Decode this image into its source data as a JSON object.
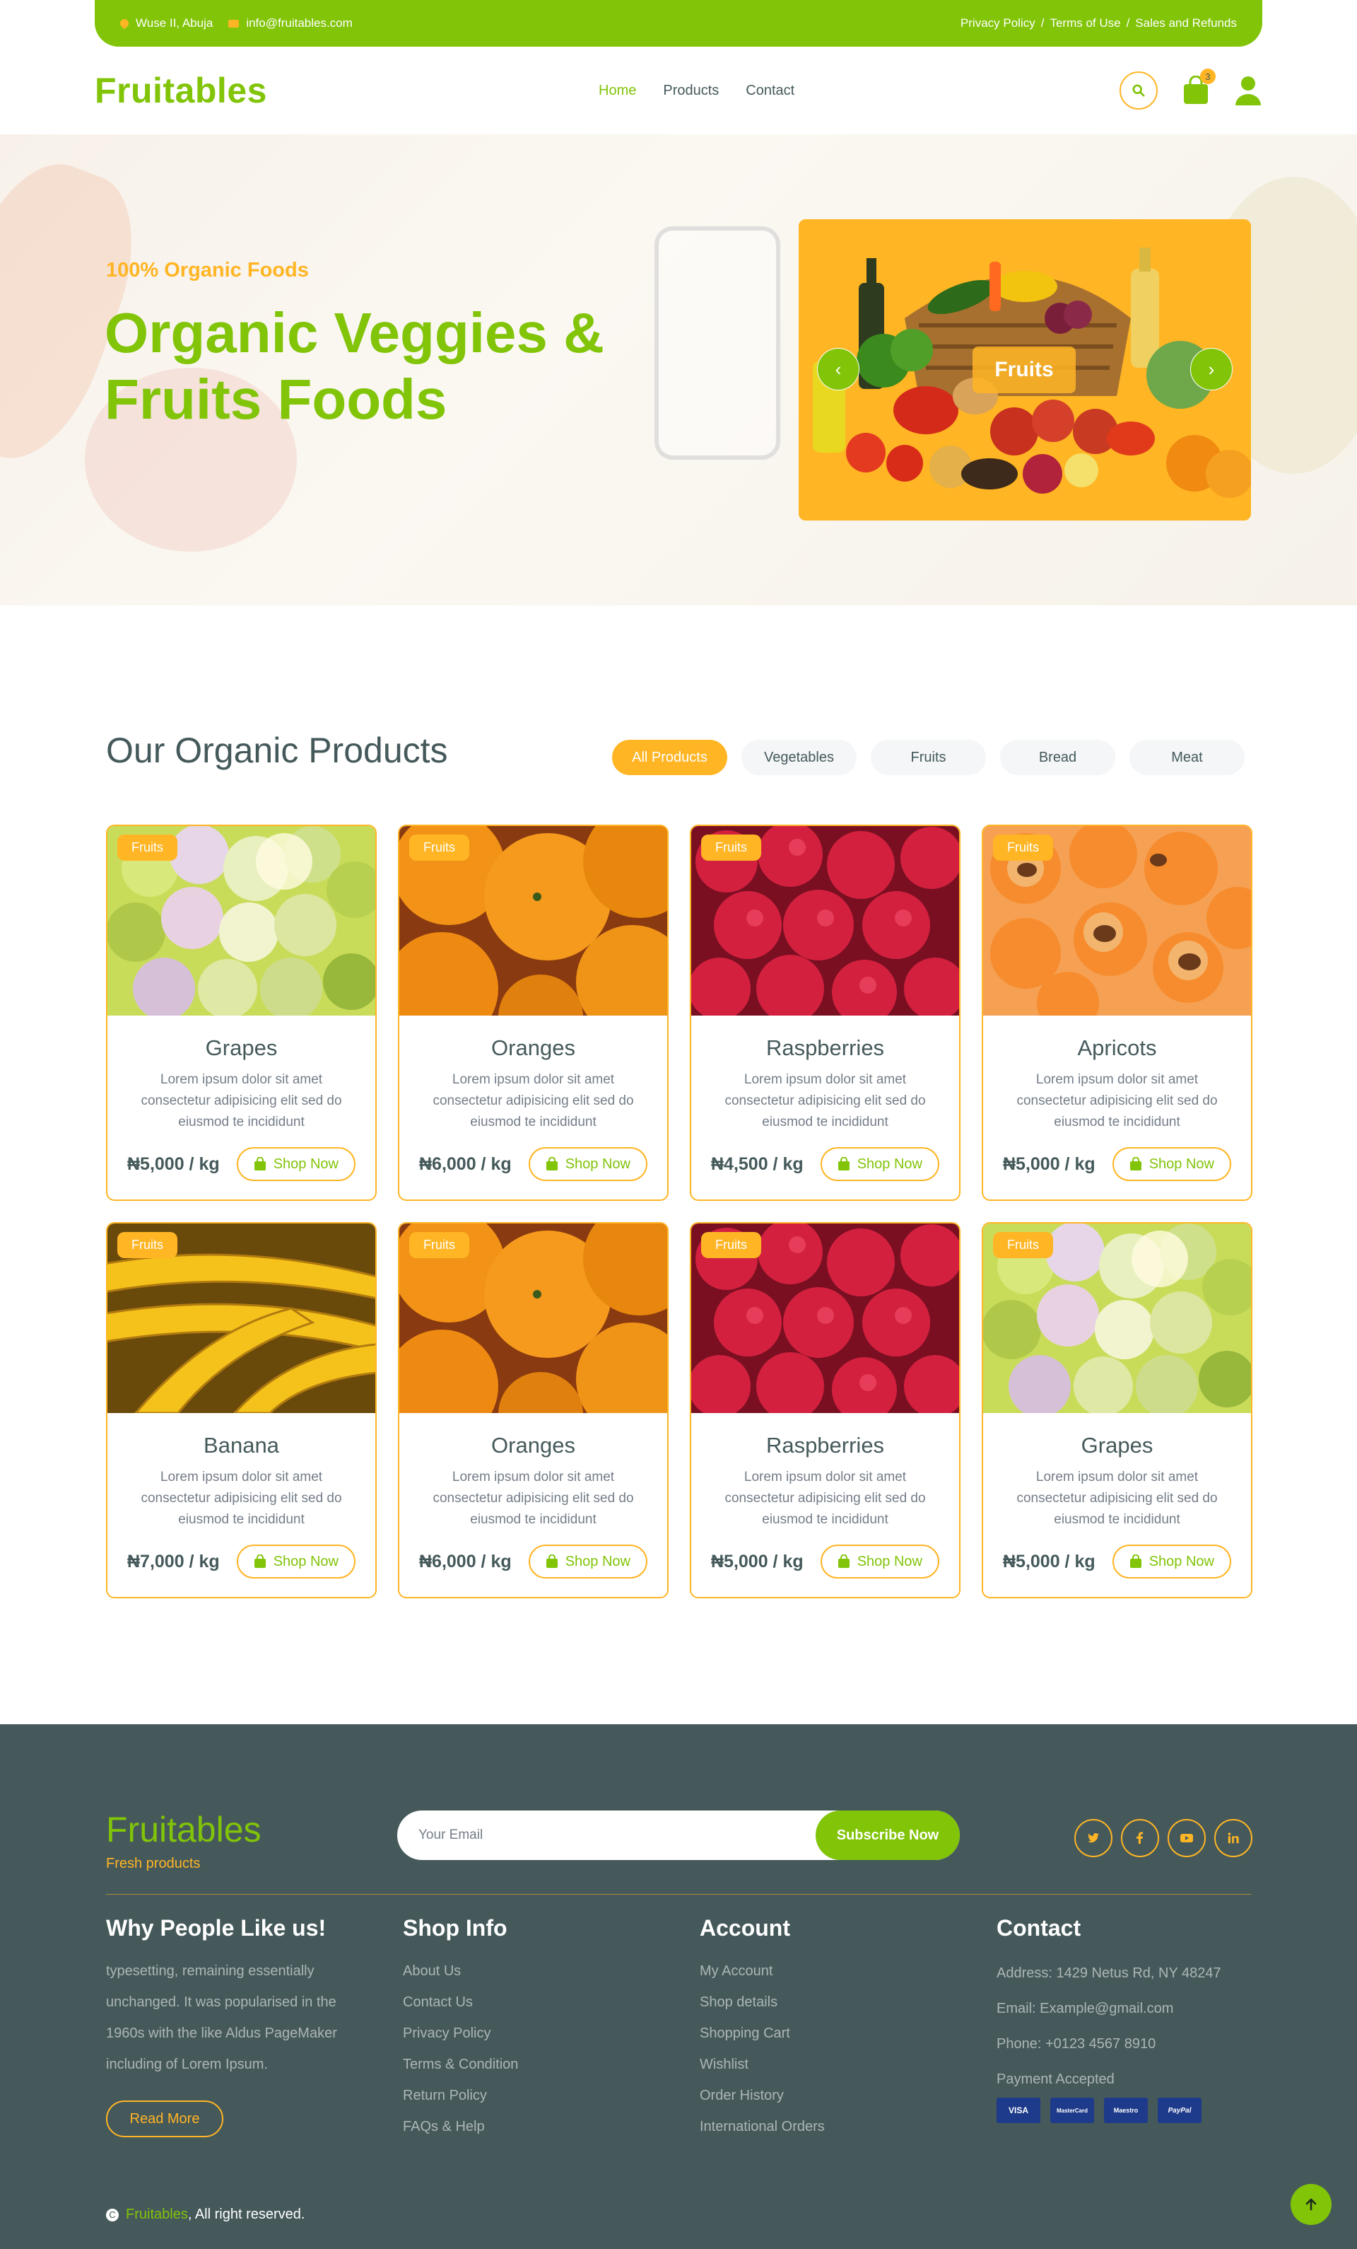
{
  "topbar": {
    "address": "Wuse II, Abuja",
    "email": "info@fruitables.com",
    "links": [
      "Privacy Policy",
      "Terms of Use",
      "Sales and Refunds"
    ],
    "separator": "/"
  },
  "nav": {
    "brand": "Fruitables",
    "menu": [
      "Home",
      "Products",
      "Contact"
    ],
    "active": "Home",
    "cart_count": "3",
    "icons": [
      "search-icon",
      "shopping-bag-icon",
      "user-icon"
    ]
  },
  "hero": {
    "subtitle": "100% Organic Foods",
    "title": "Organic Veggies & Fruits Foods",
    "carousel_label": "Fruits",
    "prev": "‹",
    "next": "›"
  },
  "products": {
    "title": "Our Organic Products",
    "filters": [
      "All Products",
      "Vegetables",
      "Fruits",
      "Bread",
      "Meat"
    ],
    "active_filter": "All Products",
    "items": [
      {
        "tag": "Fruits",
        "name": "Grapes",
        "desc": "Lorem ipsum dolor sit amet consectetur adipisicing elit sed do eiusmod te incididunt",
        "price": "₦5,000 / kg",
        "cta": "Shop Now"
      },
      {
        "tag": "Fruits",
        "name": "Oranges",
        "desc": "Lorem ipsum dolor sit amet consectetur adipisicing elit sed do eiusmod te incididunt",
        "price": "₦6,000 / kg",
        "cta": "Shop Now"
      },
      {
        "tag": "Fruits",
        "name": "Raspberries",
        "desc": "Lorem ipsum dolor sit amet consectetur adipisicing elit sed do eiusmod te incididunt",
        "price": "₦4,500 / kg",
        "cta": "Shop Now"
      },
      {
        "tag": "Fruits",
        "name": "Apricots",
        "desc": "Lorem ipsum dolor sit amet consectetur adipisicing elit sed do eiusmod te incididunt",
        "price": "₦5,000 / kg",
        "cta": "Shop Now"
      },
      {
        "tag": "Fruits",
        "name": "Banana",
        "desc": "Lorem ipsum dolor sit amet consectetur adipisicing elit sed do eiusmod te incididunt",
        "price": "₦7,000 / kg",
        "cta": "Shop Now"
      },
      {
        "tag": "Fruits",
        "name": "Oranges",
        "desc": "Lorem ipsum dolor sit amet consectetur adipisicing elit sed do eiusmod te incididunt",
        "price": "₦6,000 / kg",
        "cta": "Shop Now"
      },
      {
        "tag": "Fruits",
        "name": "Raspberries",
        "desc": "Lorem ipsum dolor sit amet consectetur adipisicing elit sed do eiusmod te incididunt",
        "price": "₦5,000 / kg",
        "cta": "Shop Now"
      },
      {
        "tag": "Fruits",
        "name": "Grapes",
        "desc": "Lorem ipsum dolor sit amet consectetur adipisicing elit sed do eiusmod te incididunt",
        "price": "₦5,000 / kg",
        "cta": "Shop Now"
      }
    ]
  },
  "footer": {
    "brand": "Fruitables",
    "tagline": "Fresh products",
    "subscribe_placeholder": "Your Email",
    "subscribe_button": "Subscribe Now",
    "socials": [
      "twitter-icon",
      "facebook-icon",
      "youtube-icon",
      "linkedin-icon"
    ],
    "about_title": "Why People Like us!",
    "about_text": "typesetting, remaining essentially unchanged. It was popularised in the 1960s with the like Aldus PageMaker including of Lorem Ipsum.",
    "read_more": "Read More",
    "shop_title": "Shop Info",
    "shop_links": [
      "About Us",
      "Contact Us",
      "Privacy Policy",
      "Terms & Condition",
      "Return Policy",
      "FAQs & Help"
    ],
    "account_title": "Account",
    "account_links": [
      "My Account",
      "Shop details",
      "Shopping Cart",
      "Wishlist",
      "Order History",
      "International Orders"
    ],
    "contact_title": "Contact",
    "address": "Address: 1429 Netus Rd, NY 48247",
    "email": "Email: Example@gmail.com",
    "phone": "Phone: +0123 4567 8910",
    "payment_label": "Payment Accepted",
    "payments": [
      "VISA",
      "MasterCard",
      "Maestro",
      "PayPal"
    ],
    "copyright_brand": "Fruitables",
    "copyright_text": ", All right reserved."
  },
  "colors": {
    "primary": "#81c408",
    "secondary": "#ffb524",
    "dark": "#45595b"
  }
}
